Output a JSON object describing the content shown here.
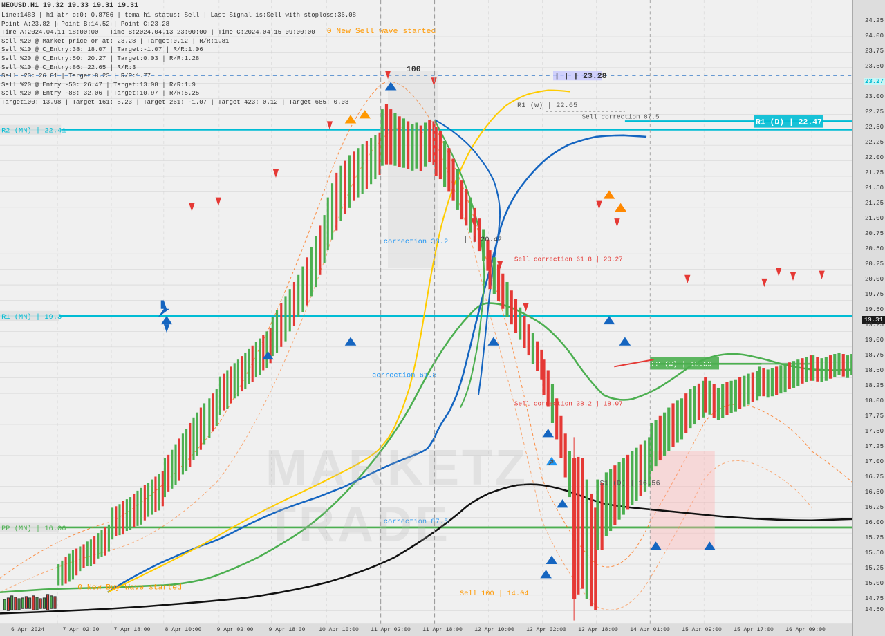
{
  "header": {
    "symbol": "NEOUSD.H1",
    "prices": "19.32 19.33 19.31 19.31",
    "line1": "Line:1483 | h1_atr_c:0: 0.8786 | tema_h1_status: Sell | Last Signal is:Sell with stoploss:36.08",
    "line2": "Point A:23.82 | Point B:14.52 | Point C:23.28",
    "line3": "Time A:2024.04.11 18:00:00 | Time B:2024.04.13 23:00:00 | Time C:2024.04.15 09:00:00",
    "line4": "Sell %20 @ Market price or at: 23.28 | Target:0.12 | R/R:1.81",
    "line5": "Sell %10 @ C_Entry:38: 18.07 | Target:-1.07 | R/R:1.06",
    "line6": "Sell %20 @ C_Entry:50: 20.27 | Target:0.03 | R/R:1.28",
    "line7": "Sell %10 @ C_Entry:86: 22.65 | R/R:3",
    "line8": "Sell -23: 26.01 | Target:8.23 | R/R:1.77",
    "line9": "Sell %20 @ Entry -50: 26.47 | Target:13.98 | R/R:1.9",
    "line10": "Sell %20 @ Entry -88: 32.06 | Target:10.97 | R/R:5.25",
    "line11": "Target100: 13.98 | Target 161: 8.23 | Target 261: -1.07 | Target 423: 0.12 | Target 685: 0.03"
  },
  "levels": {
    "r2_mn": "R2 (MN) | 22.41",
    "r1_mn": "R1 (MN) | 19.3",
    "pp_mn": "PP (MN) | 16.06",
    "r1_d": "R1 (D) | 22.47",
    "r1_w": "R1 (w) | 22.65",
    "pp_w": "PP (w) | 18.59",
    "s1_d": "S1 (D) | 16.56",
    "current_price": "19.31",
    "sell_correction_r1_w": "Sell correction 87.5",
    "sell_correction_b": "Sell correction 61.8 | 20.27",
    "sell_correction_382": "Sell correction 38.2 | 18.07",
    "price_2328": "23.28",
    "sell_100": "Sell 100 | 14.04",
    "new_sell_wave": "0 New Sell wave started",
    "new_buy_wave": "0 New Buy Wave started",
    "correction_382": "correction 38.2",
    "correction_618": "correction 61.8",
    "correction_875": "correction 87.5",
    "point_100": "100",
    "point_2042": "20.42"
  },
  "time_labels": [
    "6 Apr 2024",
    "7 Apr 02:00",
    "7 Apr 18:00",
    "8 Apr 10:00",
    "9 Apr 02:00",
    "9 Apr 18:00",
    "10 Apr 10:00",
    "11 Apr 02:00",
    "11 Apr 18:00",
    "12 Apr 10:00",
    "13 Apr 02:00",
    "13 Apr 18:00",
    "14 Apr 01:00",
    "15 Apr 09:00",
    "15 Apr 17:00",
    "16 Apr 09:00"
  ],
  "price_scale": [
    "24.25",
    "24.00",
    "23.75",
    "23.50",
    "23.25",
    "23.00",
    "22.75",
    "22.50",
    "22.25",
    "22.00",
    "21.75",
    "21.50",
    "21.25",
    "21.00",
    "20.75",
    "20.50",
    "20.25",
    "20.00",
    "19.75",
    "19.50",
    "19.25",
    "19.00",
    "18.75",
    "18.50",
    "18.25",
    "18.00",
    "17.75",
    "17.50",
    "17.25",
    "17.00",
    "16.75",
    "16.50",
    "16.25",
    "16.00",
    "15.75",
    "15.50",
    "15.25",
    "15.00",
    "14.75",
    "14.50"
  ],
  "watermark": "MARKETZ TRADE",
  "colors": {
    "background": "#f0f0f0",
    "cyan_line": "#00bcd4",
    "green_line": "#4caf50",
    "blue_line": "#1565c0",
    "yellow_line": "#ffeb3b",
    "black_line": "#000000",
    "red_arrow": "#e53935",
    "blue_arrow": "#1565c0",
    "dashed_orange": "#ff6600",
    "current_price_bg": "#1a1a1a"
  }
}
